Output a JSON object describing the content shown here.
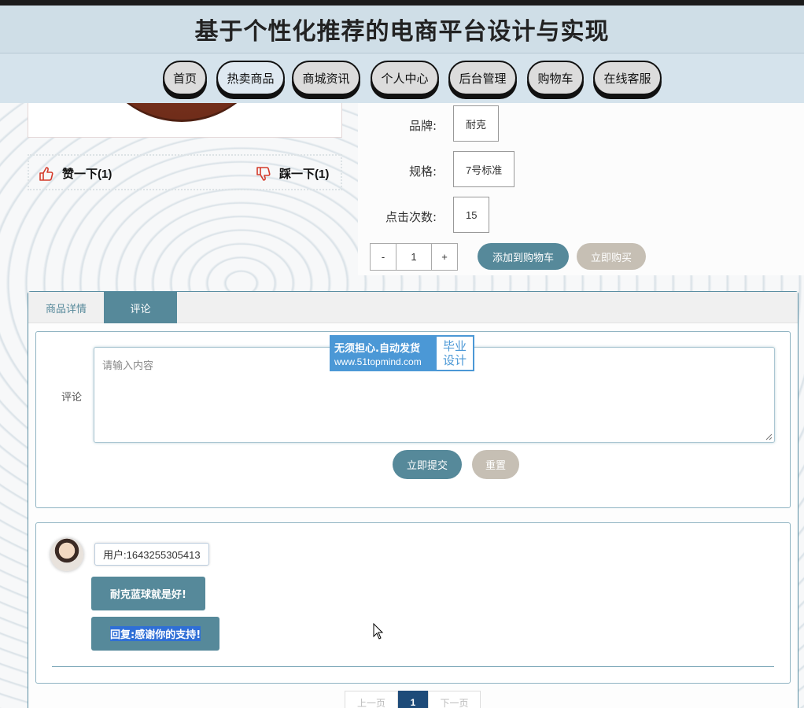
{
  "header": {
    "title": "基于个性化推荐的电商平台设计与实现"
  },
  "nav": {
    "items": [
      {
        "label": "首页"
      },
      {
        "label": "热卖商品"
      },
      {
        "label": "商城资讯"
      },
      {
        "label": "个人中心"
      },
      {
        "label": "后台管理"
      },
      {
        "label": "购物车"
      },
      {
        "label": "在线客服"
      }
    ],
    "active_index": 1
  },
  "votes": {
    "like": "赞一下(1)",
    "dislike": "踩一下(1)"
  },
  "product": {
    "brand_label": "品牌:",
    "brand_value": "耐克",
    "spec_label": "规格:",
    "spec_value": "7号标准",
    "clicks_label": "点击次数:",
    "clicks_value": "15",
    "qty_minus": "-",
    "qty_value": "1",
    "qty_plus": "+",
    "add_cart": "添加到购物车",
    "buy_now": "立即购买"
  },
  "tabs": {
    "detail": "商品详情",
    "comments": "评论",
    "active": "comments"
  },
  "comment_form": {
    "label": "评论",
    "placeholder": "请输入内容",
    "submit": "立即提交",
    "reset": "重置"
  },
  "watermark": {
    "line1": "无须担心.自动发货",
    "line2": "www.51topmind.com",
    "right1": "毕业",
    "right2": "设计"
  },
  "comments": [
    {
      "user": "用户:1643255305413",
      "content": "耐克蓝球就是好!",
      "reply": "回复:感谢你的支持!"
    }
  ],
  "pagination": {
    "prev": "上一页",
    "current": "1",
    "next": "下一页"
  },
  "colors": {
    "accent": "#56899a",
    "header_bg": "#cfdee7",
    "nav_bg": "#d5e3ec",
    "pager_active": "#1e4b79"
  }
}
